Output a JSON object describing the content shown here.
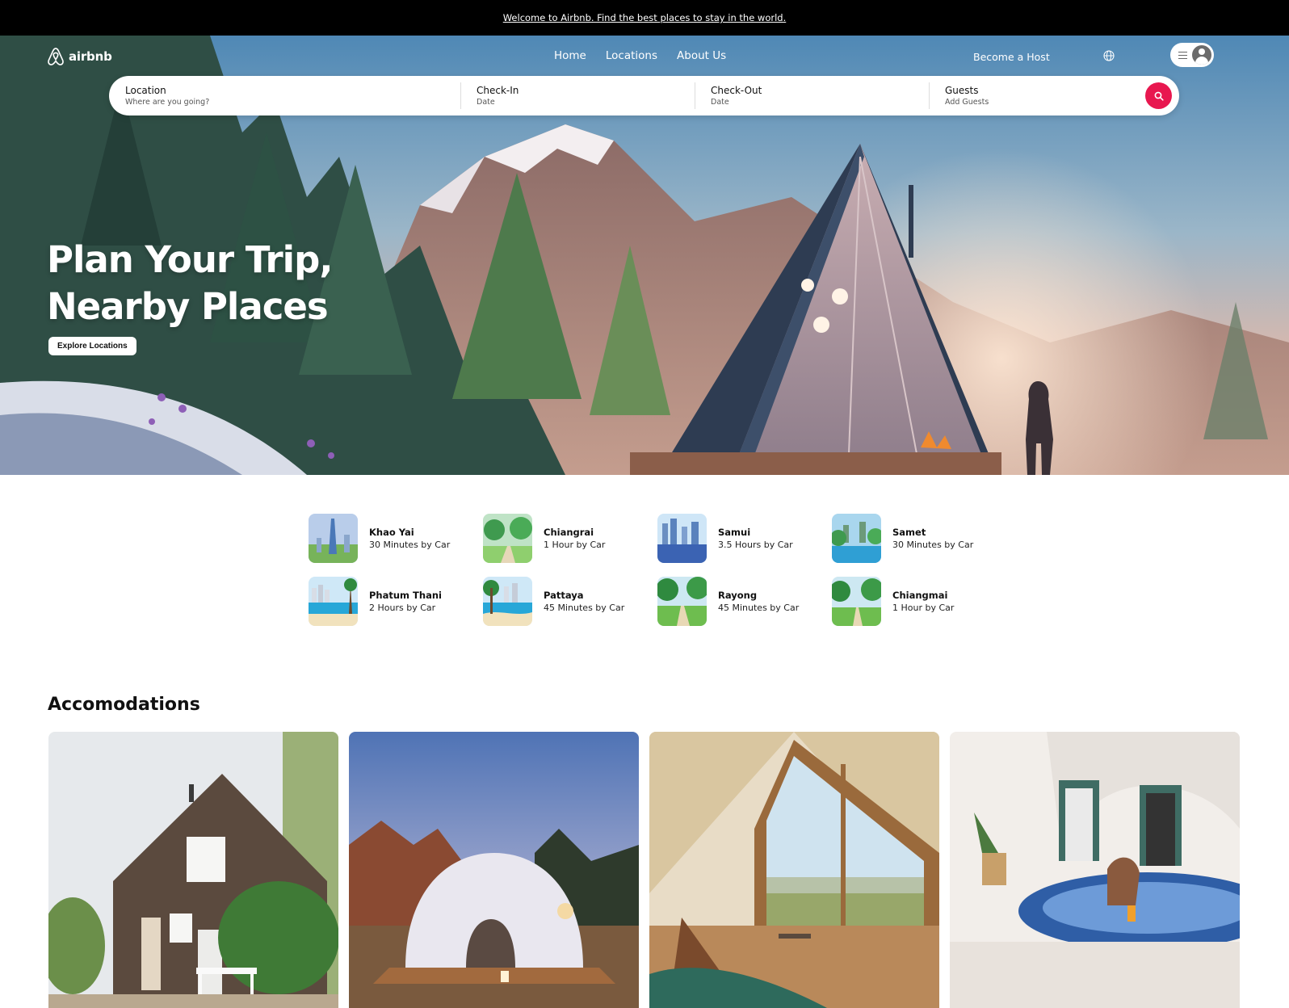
{
  "announcement": {
    "text": "Welcome to Airbnb. Find the best places to stay in the world."
  },
  "brand": {
    "name": "airbnb",
    "icon": "airbnb-logo-icon",
    "accent": "#e8174f"
  },
  "nav": {
    "links": [
      "Home",
      "Locations",
      "About Us"
    ],
    "host_label": "Become a Host",
    "globe_icon": "globe-icon",
    "menu_icon": "hamburger-icon",
    "avatar_icon": "user-avatar-icon"
  },
  "search": {
    "location": {
      "label": "Location",
      "value": "Where are you going?"
    },
    "checkin": {
      "label": "Check-In",
      "value": "Date"
    },
    "checkout": {
      "label": "Check-Out",
      "value": "Date"
    },
    "guests": {
      "label": "Guests",
      "value": "Add Guests"
    },
    "button_icon": "search-icon"
  },
  "hero": {
    "headline_line1": "Plan Your Trip,",
    "headline_line2": "Nearby Places",
    "cta": "Explore Locations"
  },
  "locations": [
    {
      "name": "Khao Yai",
      "distance": "30 Minutes by Car"
    },
    {
      "name": "Chiangrai",
      "distance": "1 Hour by Car"
    },
    {
      "name": "Samui",
      "distance": "3.5 Hours by Car"
    },
    {
      "name": "Samet",
      "distance": "30 Minutes by Car"
    },
    {
      "name": "Phatum Thani",
      "distance": "2 Hours by Car"
    },
    {
      "name": "Pattaya",
      "distance": "45 Minutes by Car"
    },
    {
      "name": "Rayong",
      "distance": "45 Minutes by Car"
    },
    {
      "name": "Chiangmai",
      "distance": "1 Hour by Car"
    }
  ],
  "accommodations": {
    "title": "Accomodations"
  }
}
